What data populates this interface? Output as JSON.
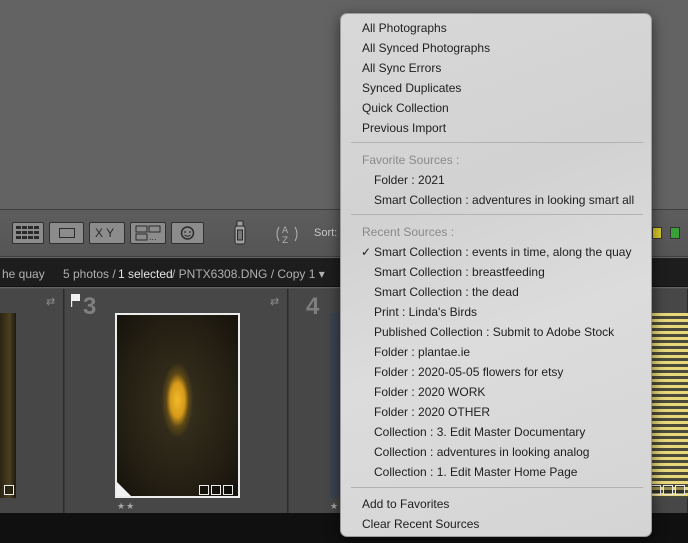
{
  "toolbar": {
    "sort_label": "Sort:",
    "xy_label": "X Y",
    "sort_az_glyph": "A Z"
  },
  "status_bar": {
    "source_fragment": "he quay",
    "photos_count": "5 photos /",
    "selected": "1 selected",
    "current_file": "/ PNTX6308.DNG / Copy 1 ▾"
  },
  "filmstrip": {
    "cells": [
      {
        "number": "3",
        "stars": "★★"
      },
      {
        "number": "4",
        "stars": "★★"
      }
    ]
  },
  "menu": {
    "top_items": [
      "All Photographs",
      "All Synced Photographs",
      "All Sync Errors",
      "Synced Duplicates",
      "Quick Collection",
      "Previous Import"
    ],
    "favorite_header": "Favorite Sources :",
    "favorite_items": [
      "Folder : 2021",
      "Smart Collection : adventures in looking smart all"
    ],
    "recent_header": "Recent Sources :",
    "checkmark": "✓",
    "recent_items": [
      "Smart Collection : events in time, along the quay",
      "Smart Collection : breastfeeding",
      "Smart Collection : the dead",
      "Print : Linda's Birds",
      "Published Collection : Submit to Adobe Stock",
      "Folder : plantae.ie",
      "Folder : 2020-05-05 flowers for etsy",
      "Folder : 2020 WORK",
      "Folder : 2020 OTHER",
      "Collection : 3. Edit Master Documentary",
      "Collection : adventures in looking analog",
      "Collection : 1. Edit Master Home Page"
    ],
    "bottom_items": [
      "Add to Favorites",
      "Clear Recent Sources"
    ]
  }
}
